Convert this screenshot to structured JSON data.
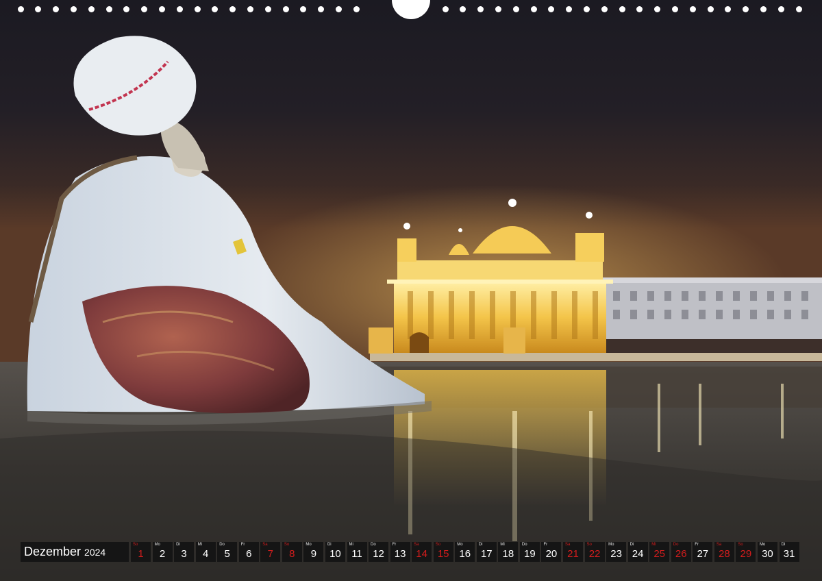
{
  "calendar": {
    "month": "Dezember",
    "year": "2024",
    "days": [
      {
        "dow": "So",
        "num": "1",
        "red": true
      },
      {
        "dow": "Mo",
        "num": "2",
        "red": false
      },
      {
        "dow": "Di",
        "num": "3",
        "red": false
      },
      {
        "dow": "Mi",
        "num": "4",
        "red": false
      },
      {
        "dow": "Do",
        "num": "5",
        "red": false
      },
      {
        "dow": "Fr",
        "num": "6",
        "red": false
      },
      {
        "dow": "Sa",
        "num": "7",
        "red": true
      },
      {
        "dow": "So",
        "num": "8",
        "red": true
      },
      {
        "dow": "Mo",
        "num": "9",
        "red": false
      },
      {
        "dow": "Di",
        "num": "10",
        "red": false
      },
      {
        "dow": "Mi",
        "num": "11",
        "red": false
      },
      {
        "dow": "Do",
        "num": "12",
        "red": false
      },
      {
        "dow": "Fr",
        "num": "13",
        "red": false
      },
      {
        "dow": "Sa",
        "num": "14",
        "red": true
      },
      {
        "dow": "So",
        "num": "15",
        "red": true
      },
      {
        "dow": "Mo",
        "num": "16",
        "red": false
      },
      {
        "dow": "Di",
        "num": "17",
        "red": false
      },
      {
        "dow": "Mi",
        "num": "18",
        "red": false
      },
      {
        "dow": "Do",
        "num": "19",
        "red": false
      },
      {
        "dow": "Fr",
        "num": "20",
        "red": false
      },
      {
        "dow": "Sa",
        "num": "21",
        "red": true
      },
      {
        "dow": "So",
        "num": "22",
        "red": true
      },
      {
        "dow": "Mo",
        "num": "23",
        "red": false
      },
      {
        "dow": "Di",
        "num": "24",
        "red": false
      },
      {
        "dow": "Mi",
        "num": "25",
        "red": true
      },
      {
        "dow": "Do",
        "num": "26",
        "red": true
      },
      {
        "dow": "Fr",
        "num": "27",
        "red": false
      },
      {
        "dow": "Sa",
        "num": "28",
        "red": true
      },
      {
        "dow": "So",
        "num": "29",
        "red": true
      },
      {
        "dow": "Mo",
        "num": "30",
        "red": false
      },
      {
        "dow": "Di",
        "num": "31",
        "red": false
      }
    ]
  },
  "colors": {
    "holiday": "#d21d1d",
    "cell_bg": "#151515",
    "sky_top": "#1b1a22",
    "haze": "#5a3a28",
    "temple_gold": "#f4c54a"
  }
}
